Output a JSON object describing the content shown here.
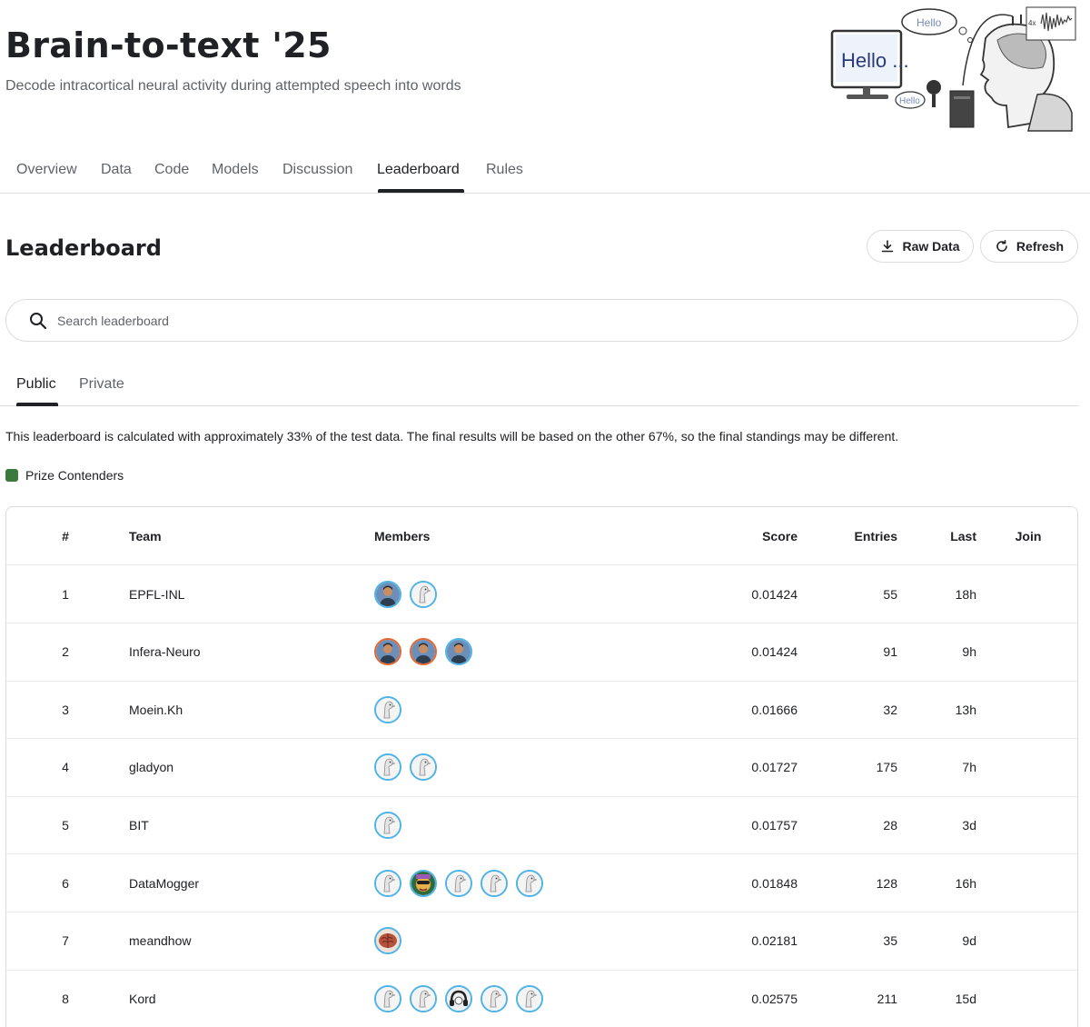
{
  "competition": {
    "title": "Brain-to-text '25",
    "subtitle": "Decode intracortical neural activity during attempted speech into words",
    "hero_text": {
      "monitor": "Hello ...",
      "bubble": "Hello",
      "small_bubble": "Hello",
      "scale": "4x"
    }
  },
  "nav": {
    "tabs": [
      "Overview",
      "Data",
      "Code",
      "Models",
      "Discussion",
      "Leaderboard",
      "Rules"
    ],
    "active": "Leaderboard"
  },
  "leaderboard": {
    "title": "Leaderboard",
    "raw_data_label": "Raw Data",
    "refresh_label": "Refresh",
    "search_placeholder": "Search leaderboard",
    "subtabs": [
      "Public",
      "Private"
    ],
    "active_subtab": "Public",
    "notice": "This leaderboard is calculated with approximately 33% of the test data. The final results will be based on the other 67%, so the final standings may be different.",
    "legend_label": "Prize Contenders",
    "legend_color": "#3b7a3e",
    "columns": {
      "rank": "#",
      "team": "Team",
      "members": "Members",
      "score": "Score",
      "entries": "Entries",
      "last": "Last",
      "join": "Join"
    },
    "rows": [
      {
        "rank": "1",
        "team": "EPFL-INL",
        "members": [
          {
            "type": "photo-person",
            "ring": "blue"
          },
          {
            "type": "default-bird",
            "ring": "blue"
          }
        ],
        "score": "0.01424",
        "entries": "55",
        "last": "18h"
      },
      {
        "rank": "2",
        "team": "Infera-Neuro",
        "members": [
          {
            "type": "photo-person",
            "ring": "orange"
          },
          {
            "type": "photo-person",
            "ring": "orange"
          },
          {
            "type": "photo-person",
            "ring": "blue"
          }
        ],
        "score": "0.01424",
        "entries": "91",
        "last": "9h"
      },
      {
        "rank": "3",
        "team": "Moein.Kh",
        "members": [
          {
            "type": "default-bird",
            "ring": "blue"
          }
        ],
        "score": "0.01666",
        "entries": "32",
        "last": "13h"
      },
      {
        "rank": "4",
        "team": "gladyon",
        "members": [
          {
            "type": "default-bird",
            "ring": "blue"
          },
          {
            "type": "default-bird",
            "ring": "blue"
          }
        ],
        "score": "0.01727",
        "entries": "175",
        "last": "7h"
      },
      {
        "rank": "5",
        "team": "BIT",
        "members": [
          {
            "type": "default-bird",
            "ring": "blue"
          }
        ],
        "score": "0.01757",
        "entries": "28",
        "last": "3d"
      },
      {
        "rank": "6",
        "team": "DataMogger",
        "members": [
          {
            "type": "default-bird",
            "ring": "blue"
          },
          {
            "type": "photo-cartoon",
            "ring": "blue"
          },
          {
            "type": "default-bird",
            "ring": "blue"
          },
          {
            "type": "default-bird",
            "ring": "blue"
          },
          {
            "type": "default-bird",
            "ring": "blue"
          }
        ],
        "score": "0.01848",
        "entries": "128",
        "last": "16h"
      },
      {
        "rank": "7",
        "team": "meandhow",
        "members": [
          {
            "type": "photo-brain",
            "ring": "blue"
          }
        ],
        "score": "0.02181",
        "entries": "35",
        "last": "9d"
      },
      {
        "rank": "8",
        "team": "Kord",
        "members": [
          {
            "type": "default-bird",
            "ring": "blue"
          },
          {
            "type": "default-bird",
            "ring": "blue"
          },
          {
            "type": "photo-headphones",
            "ring": "blue"
          },
          {
            "type": "default-bird",
            "ring": "blue"
          },
          {
            "type": "default-bird",
            "ring": "blue"
          }
        ],
        "score": "0.02575",
        "entries": "211",
        "last": "15d"
      }
    ]
  },
  "icons": {
    "search": "search-icon",
    "download": "download-icon",
    "refresh": "refresh-icon"
  }
}
